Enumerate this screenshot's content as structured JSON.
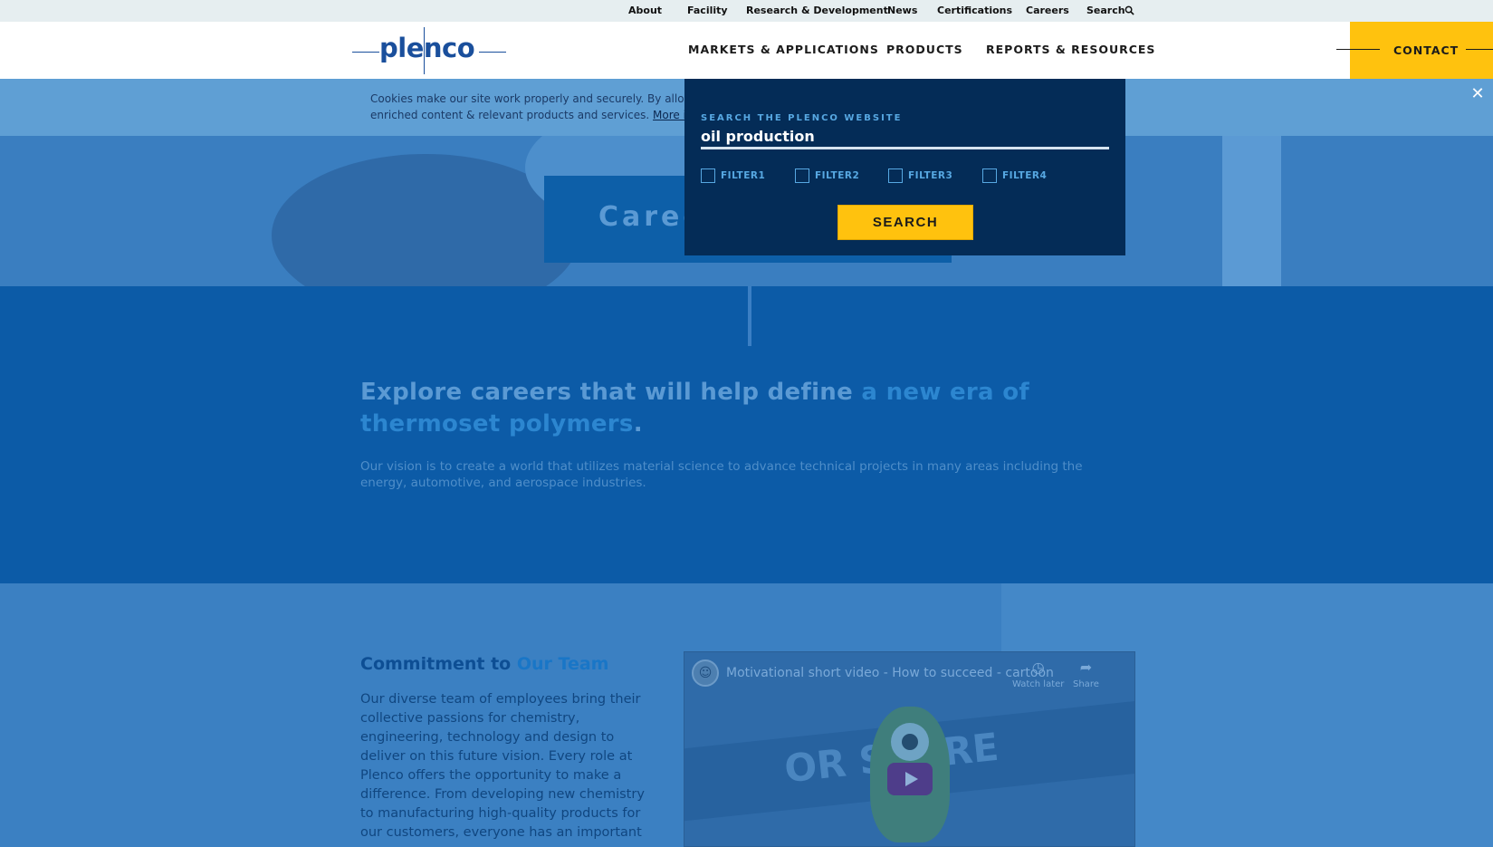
{
  "utility_nav": {
    "items": [
      {
        "label": "About"
      },
      {
        "label": "Facility"
      },
      {
        "label": "Research & Development"
      },
      {
        "label": "News"
      },
      {
        "label": "Certifications"
      },
      {
        "label": "Careers"
      },
      {
        "label": "Search"
      }
    ]
  },
  "header": {
    "logo_text": "plenco",
    "nav": [
      {
        "label": "MARKETS & APPLICATIONS"
      },
      {
        "label": "PRODUCTS"
      },
      {
        "label": "REPORTS & RESOURCES"
      }
    ],
    "contact_label": "CONTACT"
  },
  "cookie_banner": {
    "line1": "Cookies make our site work properly and securely. By allowi",
    "line2": "enriched content & relevant products and services.",
    "more_link": "More inf",
    "close_icon": "close-icon"
  },
  "hero": {
    "title": "Caree"
  },
  "intro": {
    "heading_plain": "Explore careers that will help define ",
    "heading_highlight": "a new era of thermoset polymers",
    "heading_end": ".",
    "body": "Our vision is to create a world that utilizes material science to advance technical projects in many areas including the energy, automotive, and aerospace industries."
  },
  "commitment": {
    "heading_plain": "Commitment to ",
    "heading_highlight": "Our Team",
    "body": "Our diverse team of employees bring their collective passions for chemistry, engineering, technology and design to deliver on this future vision. Every role at Plenco offers the opportunity to make a difference. From developing new chemistry to manufacturing high-quality products for our customers, everyone has an important"
  },
  "video": {
    "title": "Motivational short video - How to succeed - cartoon",
    "watch_later": "Watch later",
    "share": "Share",
    "banner_text": "OR SCARE"
  },
  "search_modal": {
    "label": "SEARCH THE PLENCO WEBSITE",
    "query": "oil production",
    "filters": [
      {
        "label": "FILTER1",
        "checked": false
      },
      {
        "label": "FILTER2",
        "checked": false
      },
      {
        "label": "FILTER3",
        "checked": false
      },
      {
        "label": "FILTER4",
        "checked": false
      }
    ],
    "button_label": "SEARCH"
  },
  "colors": {
    "accent_yellow": "#ffc20e",
    "brand_blue": "#1a4f9c",
    "modal_bg": "#042c57"
  }
}
